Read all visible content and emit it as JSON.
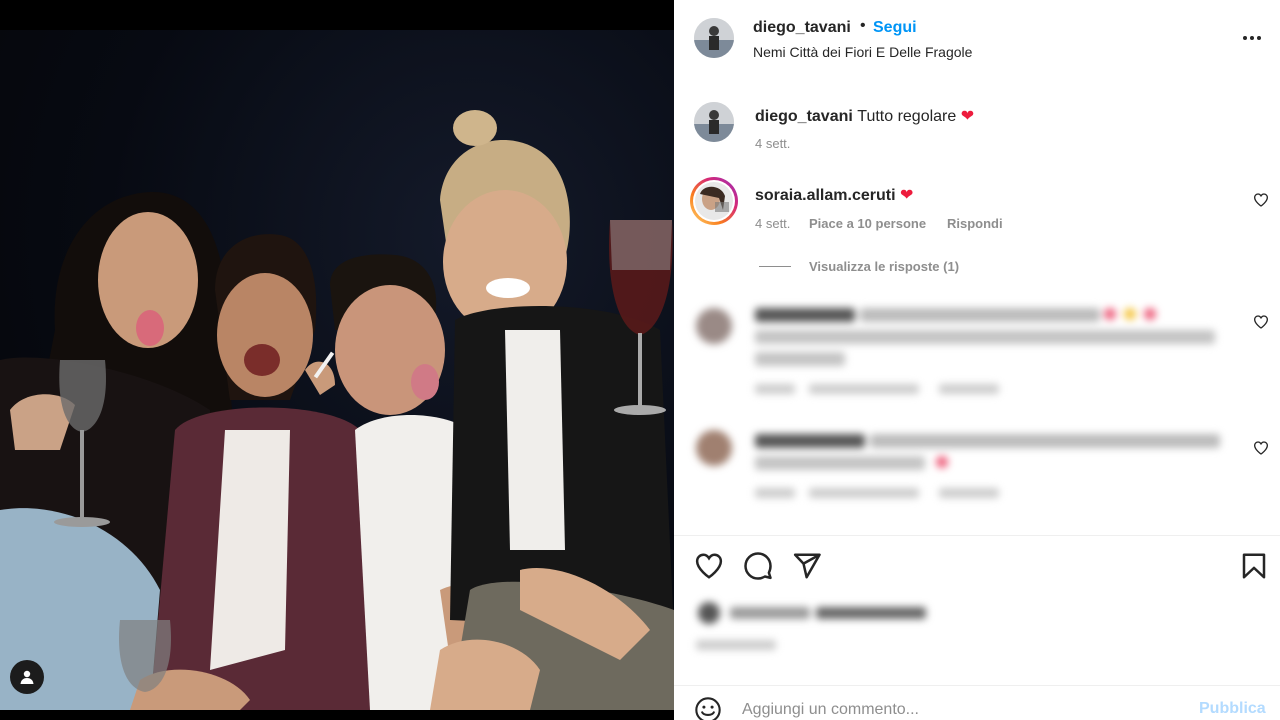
{
  "post": {
    "author": "diego_tavani",
    "separator": "•",
    "follow_label": "Segui",
    "location": "Nemi Città dei Fiori E Delle Fragole",
    "more_icon": "more-horizontal-icon"
  },
  "caption": {
    "user": "diego_tavani",
    "text": "Tutto regolare",
    "emoji": "❤",
    "time": "4 sett."
  },
  "comments": [
    {
      "user": "soraia.allam.ceruti",
      "emoji": "❤",
      "time": "4 sett.",
      "likes": "Piace a 10 persone",
      "reply_label": "Rispondi",
      "view_replies_label": "Visualizza le risposte (1)",
      "blurred": false
    },
    {
      "blurred": true
    },
    {
      "blurred": true
    }
  ],
  "actions": {
    "like_icon": "heart-outline-icon",
    "comment_icon": "comment-bubble-icon",
    "share_icon": "paper-plane-icon",
    "save_icon": "bookmark-icon"
  },
  "add_comment": {
    "placeholder": "Aggiungi un commento...",
    "publish_label": "Pubblica"
  },
  "colors": {
    "accent": "#0095f6",
    "publish_disabled": "#b3dbff",
    "heart": "#ed1c3d",
    "muted": "#8e8e8e"
  }
}
